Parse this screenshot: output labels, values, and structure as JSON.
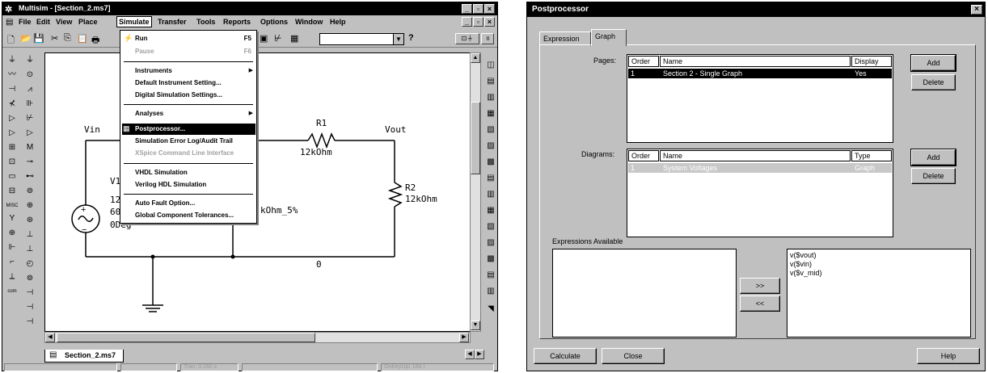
{
  "multisim": {
    "title": "Multisim - [Section_2.ms7]",
    "menu": [
      "File",
      "Edit",
      "View",
      "Place",
      "Simulate",
      "Transfer",
      "Tools",
      "Reports",
      "Options",
      "Window",
      "Help"
    ],
    "simulate_menu": {
      "run": "Run",
      "run_key": "F5",
      "pause": "Pause",
      "pause_key": "F6",
      "instruments": "Instruments",
      "default_instrument": "Default Instrument Setting...",
      "digital_sim": "Digital Simulation Settings...",
      "analyses": "Analyses",
      "postprocessor": "Postprocessor...",
      "error_log": "Simulation Error Log/Audit Trail",
      "xspice": "XSpice Command Line Interface",
      "vhdl": "VHDL Simulation",
      "verilog": "Verilog HDL Simulation",
      "auto_fault": "Auto Fault Option...",
      "global_tol": "Global Component Tolerances..."
    },
    "schematic": {
      "vin": "Vin",
      "vout": "Vout",
      "r1": "R1",
      "r1_val": "12kOhm",
      "r2": "R2",
      "r2_val": "12kOhm",
      "v1": "V1",
      "v1_l1": "12",
      "v1_l2": "60",
      "v1_l3": "0Deg",
      "rmid": "kOhm_5%",
      "node0": "0"
    },
    "tab": "Section_2.ms7",
    "status": [
      "",
      "",
      "Tran: 0.160 s",
      "",
      "OnKeyUp( 18d )"
    ]
  },
  "postprocessor": {
    "title": "Postprocessor",
    "tabs": [
      "Expression",
      "Graph"
    ],
    "pages_label": "Pages:",
    "diagrams_label": "Diagrams:",
    "pages_headers": [
      "Order",
      "Name",
      "Display"
    ],
    "pages_rows": [
      {
        "order": "1",
        "name": "Section 2 - Single Graph",
        "display": "Yes"
      }
    ],
    "diagrams_headers": [
      "Order",
      "Name",
      "Type"
    ],
    "diagrams_rows": [
      {
        "order": "1",
        "name": "System Voltages",
        "type": "Graph"
      }
    ],
    "add": "Add",
    "delete": "Delete",
    "expressions_available": "Expressions Available",
    "move_right": ">>",
    "move_left": "<<",
    "expressions": [
      "v($vout)",
      "v($vin)",
      "v($v_mid)"
    ],
    "calculate": "Calculate",
    "close": "Close",
    "help": "Help"
  }
}
